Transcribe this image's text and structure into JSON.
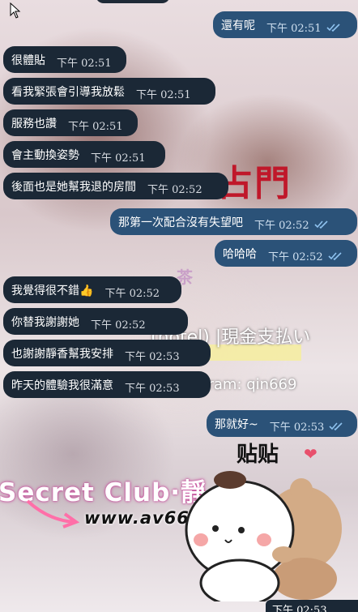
{
  "background": {
    "watermark_chinese": "占門",
    "watermark_tea": "茶",
    "watermark_hotel": "(hotel) |現金支払い",
    "watermark_telegram": "egram: qin669",
    "watermark_club": "Secret Club·靜",
    "watermark_url": "www.av66",
    "sticker_text": "贴贴",
    "heart": "❤"
  },
  "messages": [
    {
      "dir": "out",
      "text": "還有呢",
      "time": "下午 02:51",
      "read": true
    },
    {
      "dir": "in",
      "text": "很體貼",
      "time": "下午 02:51"
    },
    {
      "dir": "in",
      "text": "看我緊張會引導我放鬆",
      "time": "下午 02:51"
    },
    {
      "dir": "in",
      "text": "服務也讚",
      "time": "下午 02:51"
    },
    {
      "dir": "in",
      "text": "會主動換姿勢",
      "time": "下午 02:51"
    },
    {
      "dir": "in",
      "text": "後面也是她幫我退的房間",
      "time": "下午 02:52"
    },
    {
      "dir": "out",
      "text": "那第一次配合沒有失望吧",
      "time": "下午 02:52",
      "read": true
    },
    {
      "dir": "out",
      "text": "哈哈哈",
      "time": "下午 02:52",
      "read": true
    },
    {
      "dir": "in",
      "text": "我覺得很不錯👍",
      "time": "下午 02:52"
    },
    {
      "dir": "in",
      "text": "你替我謝謝她",
      "time": "下午 02:52"
    },
    {
      "dir": "in",
      "text": "也謝謝靜香幫我安排",
      "time": "下午 02:53"
    },
    {
      "dir": "in",
      "text": "昨天的體驗我很滿意",
      "time": "下午 02:53"
    },
    {
      "dir": "out",
      "text": "那就好~",
      "time": "下午 02:53",
      "read": true
    }
  ],
  "sticker_time": "下午 02:53"
}
